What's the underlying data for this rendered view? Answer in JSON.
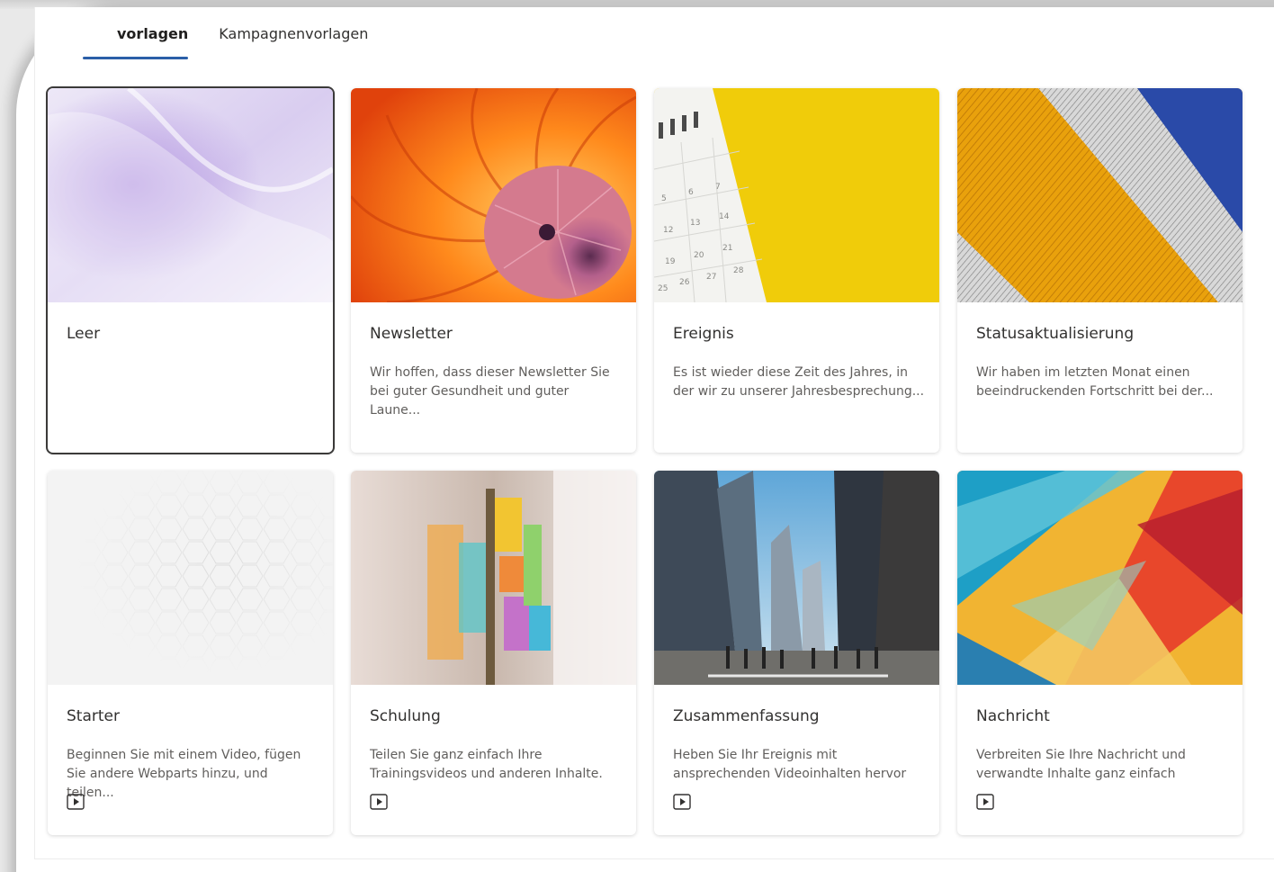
{
  "tabs": [
    {
      "label": "vorlagen",
      "active": true
    },
    {
      "label": "Kampagnenvorlagen",
      "active": false
    }
  ],
  "templates": [
    {
      "title": "Leer",
      "description": "",
      "has_video": false,
      "selected": true,
      "thumbnail": "lavender-wave"
    },
    {
      "title": "Newsletter",
      "description": "Wir hoffen, dass dieser Newsletter Sie bei guter Gesundheit und guter Laune...",
      "has_video": false,
      "selected": false,
      "thumbnail": "nautilus-shell"
    },
    {
      "title": "Ereignis",
      "description": "Es ist wieder diese Zeit des Jahres, in der wir zu unserer Jahresbesprechung...",
      "has_video": false,
      "selected": false,
      "thumbnail": "calendar-yellow"
    },
    {
      "title": "Statusaktualisierung",
      "description": "Wir haben im letzten Monat einen beeindruckenden Fortschritt bei der...",
      "has_video": false,
      "selected": false,
      "thumbnail": "orange-stripes"
    },
    {
      "title": "Starter",
      "description": "Beginnen Sie mit einem Video, fügen Sie andere Webparts hinzu, und teilen...",
      "has_video": true,
      "selected": false,
      "thumbnail": "hexagon-pattern"
    },
    {
      "title": "Schulung",
      "description": "Teilen Sie ganz einfach Ihre Trainingsvideos und anderen Inhalte.",
      "has_video": true,
      "selected": false,
      "thumbnail": "sticky-notes"
    },
    {
      "title": "Zusammenfassung",
      "description": "Heben Sie Ihr Ereignis mit ansprechenden Videoinhalten hervor",
      "has_video": true,
      "selected": false,
      "thumbnail": "city-street"
    },
    {
      "title": "Nachricht",
      "description": "Verbreiten Sie Ihre Nachricht und verwandte Inhalte ganz einfach",
      "has_video": true,
      "selected": false,
      "thumbnail": "colorful-triangles"
    }
  ],
  "colors": {
    "tab_underline": "#2b5fa8",
    "card_title": "#323130",
    "card_desc": "#605e5c"
  }
}
